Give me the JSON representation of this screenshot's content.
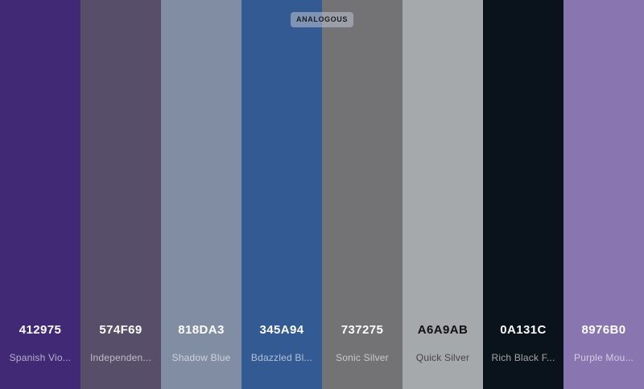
{
  "palette": {
    "mode_badge": "ANALOGOUS",
    "swatches": [
      {
        "hex": "412975",
        "name": "Spanish Vio...",
        "color": "#412975",
        "text": "light"
      },
      {
        "hex": "574F69",
        "name": "Independen...",
        "color": "#574F69",
        "text": "light"
      },
      {
        "hex": "818DA3",
        "name": "Shadow Blue",
        "color": "#818DA3",
        "text": "light"
      },
      {
        "hex": "345A94",
        "name": "Bdazzled Bl...",
        "color": "#345A94",
        "text": "light"
      },
      {
        "hex": "737275",
        "name": "Sonic Silver",
        "color": "#737275",
        "text": "light"
      },
      {
        "hex": "A6A9AB",
        "name": "Quick Silver",
        "color": "#A6A9AB",
        "text": "dark"
      },
      {
        "hex": "0A131C",
        "name": "Rich Black F...",
        "color": "#0A131C",
        "text": "light"
      },
      {
        "hex": "8976B0",
        "name": "Purple Mou...",
        "color": "#8976B0",
        "text": "light"
      }
    ]
  }
}
